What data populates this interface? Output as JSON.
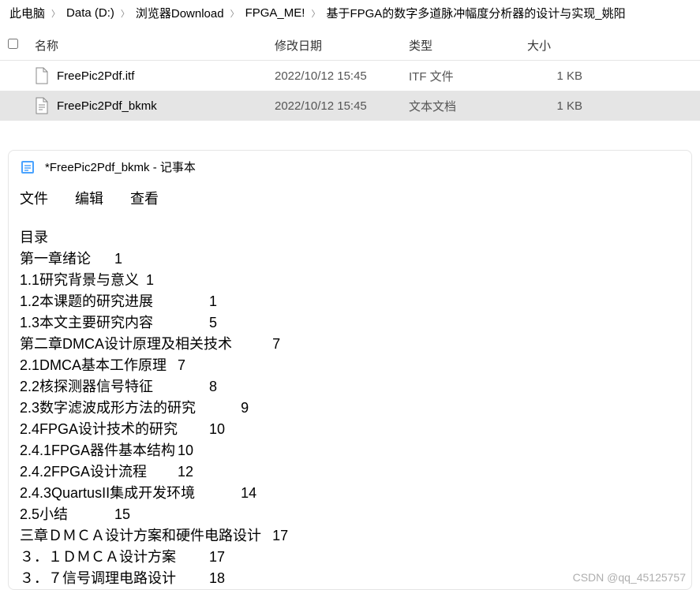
{
  "breadcrumb": {
    "items": [
      {
        "label": "此电脑"
      },
      {
        "label": "Data (D:)"
      },
      {
        "label": "浏览器Download"
      },
      {
        "label": "FPGA_ME!"
      },
      {
        "label": "基于FPGA的数字多道脉冲幅度分析器的设计与实现_姚阳"
      }
    ]
  },
  "file_list": {
    "headers": {
      "name": "名称",
      "date": "修改日期",
      "type": "类型",
      "size": "大小"
    },
    "rows": [
      {
        "name": "FreePic2Pdf.itf",
        "date": "2022/10/12 15:45",
        "type": "ITF 文件",
        "size": "1 KB",
        "selected": false,
        "icon": "file-generic-icon"
      },
      {
        "name": "FreePic2Pdf_bkmk",
        "date": "2022/10/12 15:45",
        "type": "文本文档",
        "size": "1 KB",
        "selected": true,
        "icon": "file-text-icon"
      }
    ]
  },
  "notepad": {
    "title": "*FreePic2Pdf_bkmk - 记事本",
    "menu": {
      "file": "文件",
      "edit": "编辑",
      "view": "查看"
    },
    "content_lines": [
      "目录",
      "第一章绪论\t1",
      "1.1研究背景与意义\t1",
      "1.2本课题的研究进展\t\t1",
      "1.3本文主要研究内容\t\t5",
      "第二章DMCA设计原理及相关技术\t\t7",
      "2.1DMCA基本工作原理\t7",
      "2.2核探测器信号特征\t\t8",
      "2.3数字滤波成形方法的研究\t\t9",
      "2.4FPGA设计技术的研究\t10",
      "2.4.1FPGA器件基本结构\t10",
      "2.4.2FPGA设计流程\t12",
      "2.4.3QuartusII集成开发环境\t\t14",
      "2.5小结\t\t15",
      "三章ＤＭＣＡ设计方案和硬件电路设计\t17",
      "３．１ＤＭＣＡ设计方案\t17",
      "３．７信号调理电路设计\t18"
    ]
  },
  "watermark": "CSDN @qq_45125757"
}
